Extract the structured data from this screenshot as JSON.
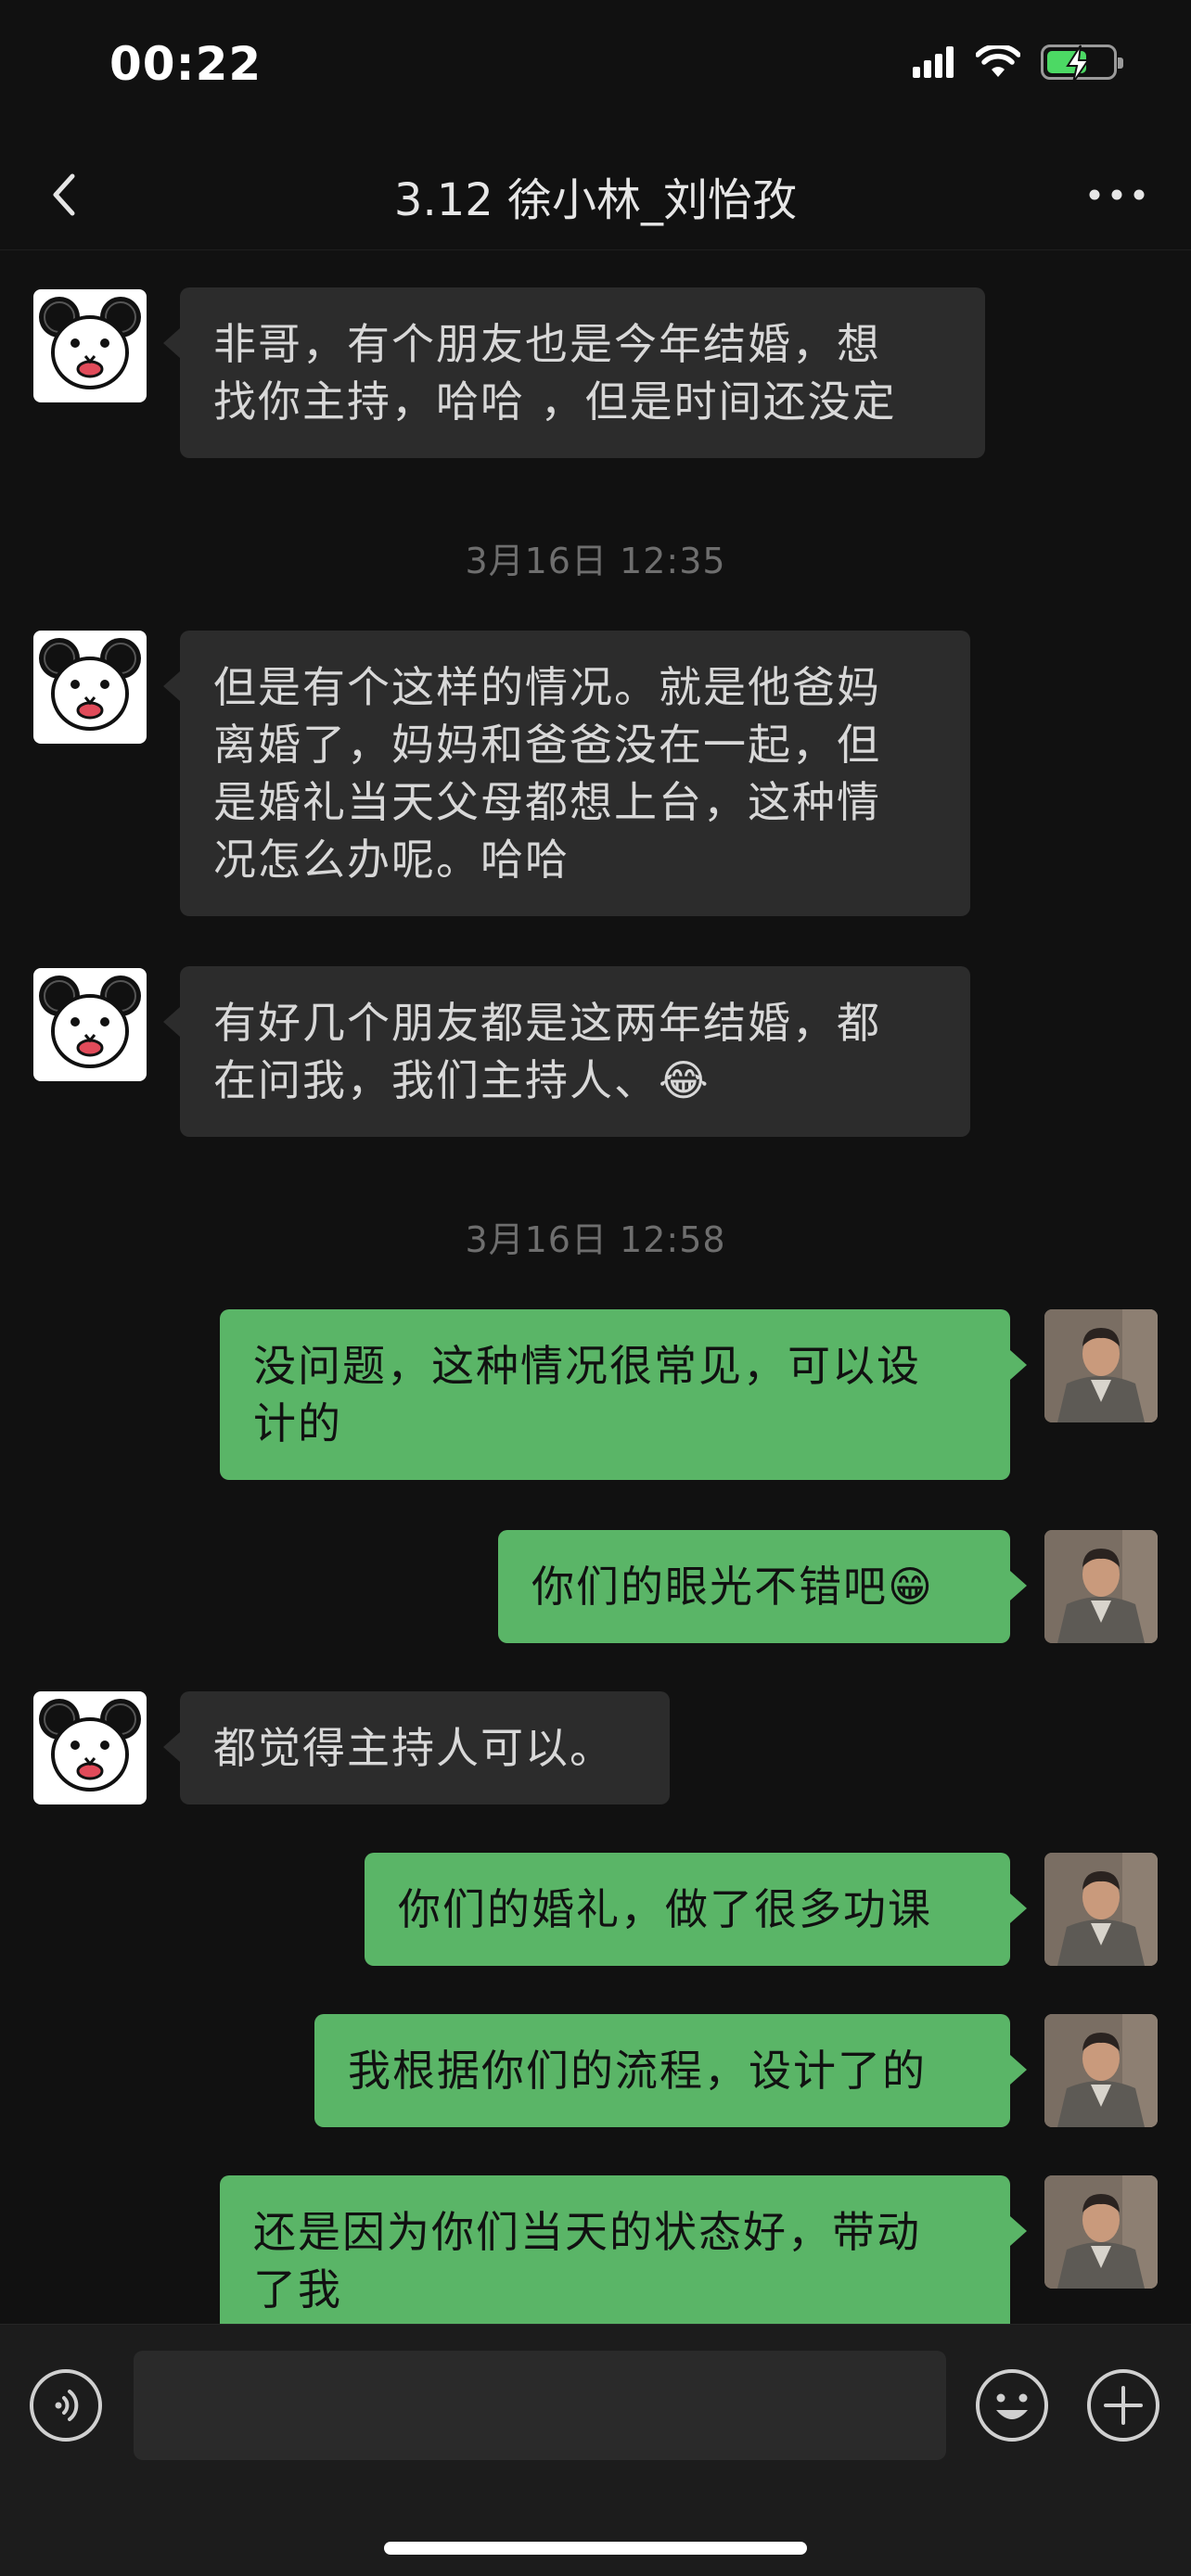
{
  "status_bar": {
    "time": "00:22",
    "signal_icon": "cellular-signal-icon",
    "wifi_icon": "wifi-icon",
    "battery_icon": "battery-charging-icon"
  },
  "navbar": {
    "title": "3.12 徐小林_刘怡孜",
    "back_icon": "chevron-left-icon",
    "more_icon": "more-dots-icon"
  },
  "messages": [
    {
      "side": "in",
      "text": "非哥，有个朋友也是今年结婚，想\n找你主持，哈哈 ，但是时间还没定",
      "avatar": "cartoon-mouse-avatar"
    },
    {
      "type": "timestamp",
      "text": "3月16日 12:35"
    },
    {
      "side": "in",
      "text": "但是有个这样的情况。就是他爸妈\n离婚了，妈妈和爸爸没在一起，但\n是婚礼当天父母都想上台，这种情\n况怎么办呢。哈哈",
      "avatar": "cartoon-mouse-avatar"
    },
    {
      "side": "in",
      "text": "有好几个朋友都是这两年结婚，都\n在问我，我们主持人、",
      "emoji": "😂",
      "avatar": "cartoon-mouse-avatar"
    },
    {
      "type": "timestamp",
      "text": "3月16日 12:58"
    },
    {
      "side": "out",
      "text": "没问题，这种情况很常见，可以设\n计的",
      "avatar": "man-in-suit-avatar"
    },
    {
      "side": "out",
      "text": "你们的眼光不错吧",
      "emoji": "😁",
      "avatar": "man-in-suit-avatar"
    },
    {
      "side": "in",
      "text": "都觉得主持人可以。",
      "avatar": "cartoon-mouse-avatar"
    },
    {
      "side": "out",
      "text": "你们的婚礼，做了很多功课",
      "avatar": "man-in-suit-avatar"
    },
    {
      "side": "out",
      "text": "我根据你们的流程，设计了的",
      "avatar": "man-in-suit-avatar"
    },
    {
      "side": "out",
      "text": "还是因为你们当天的状态好，带动\n了我",
      "avatar": "man-in-suit-avatar"
    }
  ],
  "input_bar": {
    "voice_icon": "voice-input-icon",
    "emoji_icon": "emoji-smile-icon",
    "plus_icon": "plus-circle-icon",
    "placeholder": ""
  },
  "colors": {
    "background": "#111111",
    "incoming_bubble": "#2c2c2c",
    "outgoing_bubble": "#5ab567",
    "timestamp_text": "#6e6e6e"
  }
}
